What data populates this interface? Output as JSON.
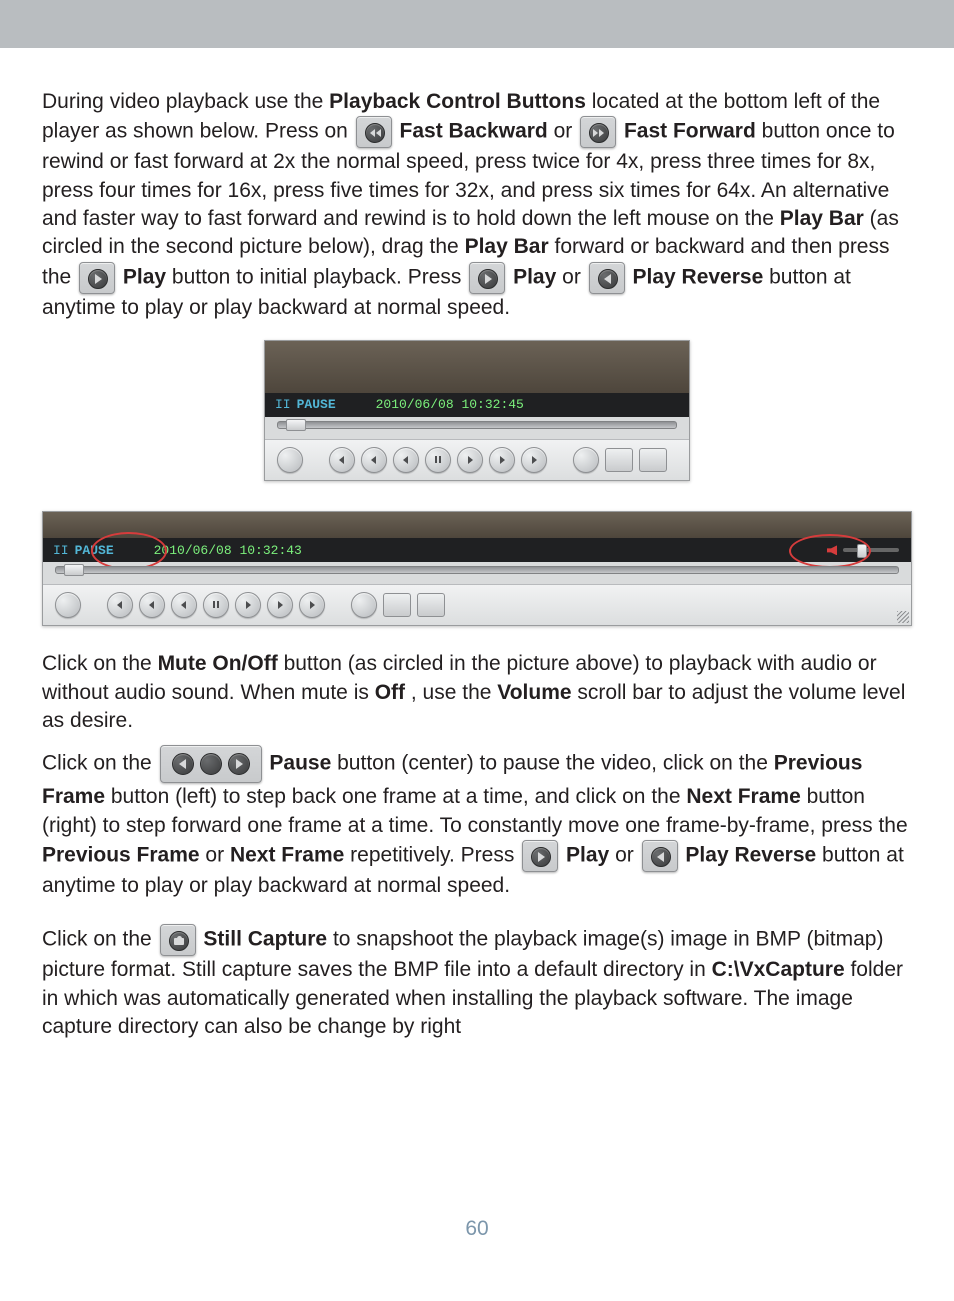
{
  "para1": {
    "t1": "During video playback use the ",
    "b1": "Playback Control Buttons",
    "t2": " located at the bottom left of the player as shown below.  Press on ",
    "b2": "Fast Backward",
    "t3": " or ",
    "b3": "Fast Forward",
    "t4": " button once to rewind or fast forward at 2x the normal speed, press twice for 4x, press three times for 8x, press four times for 16x, press five times for 32x, and press six times for 64x.  An alternative and faster way to fast forward and rewind is to hold down the left mouse on the ",
    "b4": "Play Bar",
    "t5": " (as circled in the second picture below), drag the ",
    "b5": "Play Bar",
    "t6": " forward or backward and then press the ",
    "b6": "Play",
    "t7": " button to initial playback.  Press ",
    "b7": "Play",
    "t8": " or ",
    "b8": "Play Reverse",
    "t9": " button at anytime to play or play backward at normal speed."
  },
  "shot1": {
    "status_sym": "II",
    "status_label": "PAUSE",
    "timestamp": "2010/06/08 10:32:45"
  },
  "shot2": {
    "status_sym": "II",
    "status_label": "PAUSE",
    "timestamp": "2010/06/08 10:32:43"
  },
  "para2": {
    "t1": "Click on the ",
    "b1": "Mute On/Off",
    "t2": " button (as circled in the picture above) to playback with audio or without audio sound.  When mute is ",
    "b2": "Off",
    "t3": ", use the ",
    "b3": "Volume",
    "t4": " scroll bar to adjust the volume level as desire."
  },
  "para3": {
    "t1": "Click on the ",
    "b1": "Pause",
    "t2": " button (center) to pause the video, click on the ",
    "b2": "Previous Frame",
    "t3": " button (left) to step back one frame at a time, and click on the ",
    "b3": "Next Frame",
    "t4": " button (right) to step forward one frame at a time.  To constantly move one frame-by-frame, press the ",
    "b4": "Previous Frame",
    "t5": " or ",
    "b5": "Next Frame",
    "t6": " repetitively.  Press ",
    "b6": "Play",
    "t7": " or ",
    "b7": "Play Reverse",
    "t8": " button at anytime to play or play backward at normal speed."
  },
  "para4": {
    "t1": "Click on the ",
    "b1": "Still Capture",
    "t2": " to snapshoot the playback image(s) image in BMP (bitmap) picture format. Still capture saves the BMP file into a default directory in ",
    "b2": "C:\\VxCapture",
    "t3": " folder in which was automatically generated when installing the playback software.  The image capture directory can also be change by right"
  },
  "page_number": "60"
}
